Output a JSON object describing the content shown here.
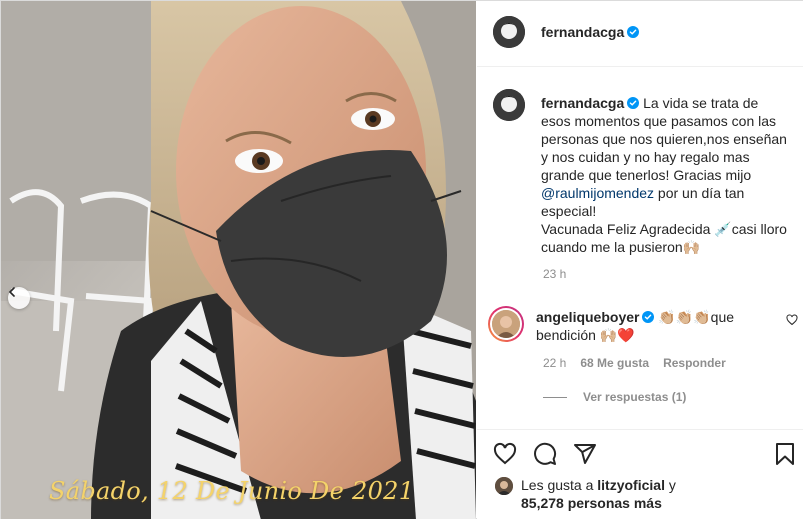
{
  "post": {
    "author": "fernandacga",
    "date_overlay": "Sábado, 12 De Junio De 2021",
    "caption": {
      "line1": "La vida se trata de",
      "line2": "esos momentos que pasamos con las",
      "line3": "personas que nos quieren,nos enseñan",
      "line4": "y nos cuidan y no hay regalo mas",
      "line5": "grande que tenerlos! Gracias mijo",
      "mention": "@raulmijomendez",
      "line6_rest": " por un día tan",
      "line7": "especial!",
      "line8": "Vacunada Feliz Agradecida 💉casi lloro",
      "line9": "cuando me la pusieron🙌🏼"
    },
    "caption_time": "23 h"
  },
  "comment": {
    "author": "angeliqueboyer",
    "text_part1": "👏🏼👏🏼👏🏼que",
    "text_part2": "bendición 🙌🏼❤️",
    "time": "22 h",
    "likes": "68 Me gusta",
    "reply": "Responder",
    "view_replies": "Ver respuestas (1)"
  },
  "likes_summary": {
    "prefix": "Les gusta a ",
    "user": "litzyoficial",
    "suffix": " y",
    "count_line": "85,278 personas más"
  },
  "icons": [
    "verified-badge-icon",
    "heart-icon",
    "comment-icon",
    "share-icon",
    "bookmark-icon",
    "chevron-left-icon"
  ],
  "colors": {
    "verified": "#0095f6",
    "link": "#00376b",
    "meta": "#8e8e8e",
    "overlay_text": "#f4d36a"
  }
}
